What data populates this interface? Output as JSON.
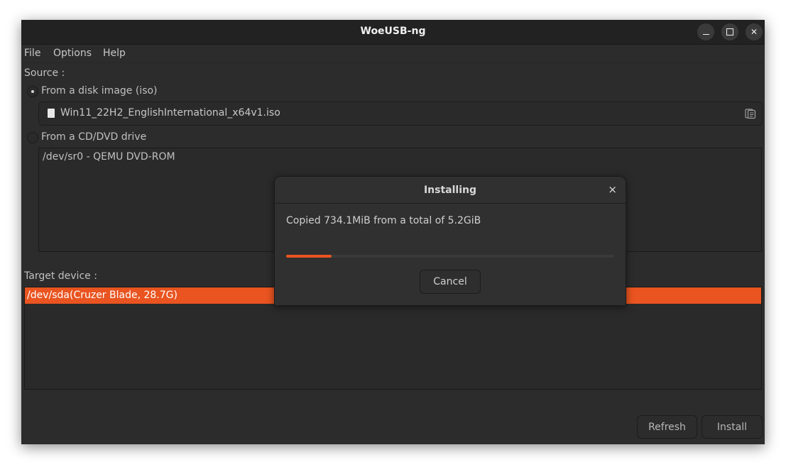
{
  "window": {
    "title": "WoeUSB-ng",
    "controls": {
      "minimize": "minimize-icon",
      "maximize": "maximize-icon",
      "close": "close-icon"
    }
  },
  "menubar": {
    "items": [
      {
        "label": "File"
      },
      {
        "label": "Options"
      },
      {
        "label": "Help"
      }
    ]
  },
  "source": {
    "label": "Source :",
    "disk_image_option": {
      "label": "From a disk image (iso)",
      "selected": true
    },
    "iso_file": {
      "name": "Win11_22H2_EnglishInternational_x64v1.iso",
      "browse_icon": "file-browse-icon"
    },
    "cd_option": {
      "label": "From a CD/DVD drive",
      "selected": false
    },
    "cd_drives": [
      "/dev/sr0 - QEMU DVD-ROM"
    ]
  },
  "target": {
    "label": "Target device :",
    "devices": [
      {
        "label": "/dev/sda(Cruzer Blade, 28.7G)",
        "selected": true
      }
    ]
  },
  "buttons": {
    "refresh": "Refresh",
    "install": "Install"
  },
  "dialog": {
    "title": "Installing",
    "message": "Copied 734.1MiB from a total of 5.2GiB",
    "progress_fraction": 0.138,
    "cancel": "Cancel",
    "close_glyph": "×"
  },
  "colors": {
    "accent": "#e95420",
    "window_bg": "#2c2c2c",
    "titlebar_bg": "#222222"
  }
}
